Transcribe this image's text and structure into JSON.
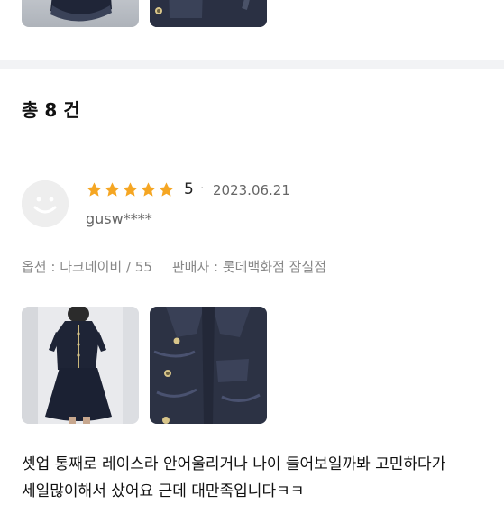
{
  "summary": {
    "total_label": "총 8 건"
  },
  "review": {
    "rating": 5,
    "rating_label": "5",
    "separator": "·",
    "date": "2023.06.21",
    "username": "gusw****",
    "option_label": "옵션 : 다크네이비 / 55",
    "seller_label": "판매자 : 롯데백화점 잠실점",
    "text_line1": "셋업 통째로 레이스라 안어울리거나 나이 들어보일까봐 고민하다가",
    "text_line2": "세일많이해서 샀어요 근데 대만족입니다ㅋㅋ"
  },
  "colors": {
    "star": "#f5a623",
    "divider": "#f2f3f5",
    "muted_text": "#888888",
    "navy": "#262c3d"
  },
  "icons": [
    "star-icon",
    "smiley-avatar-icon"
  ]
}
